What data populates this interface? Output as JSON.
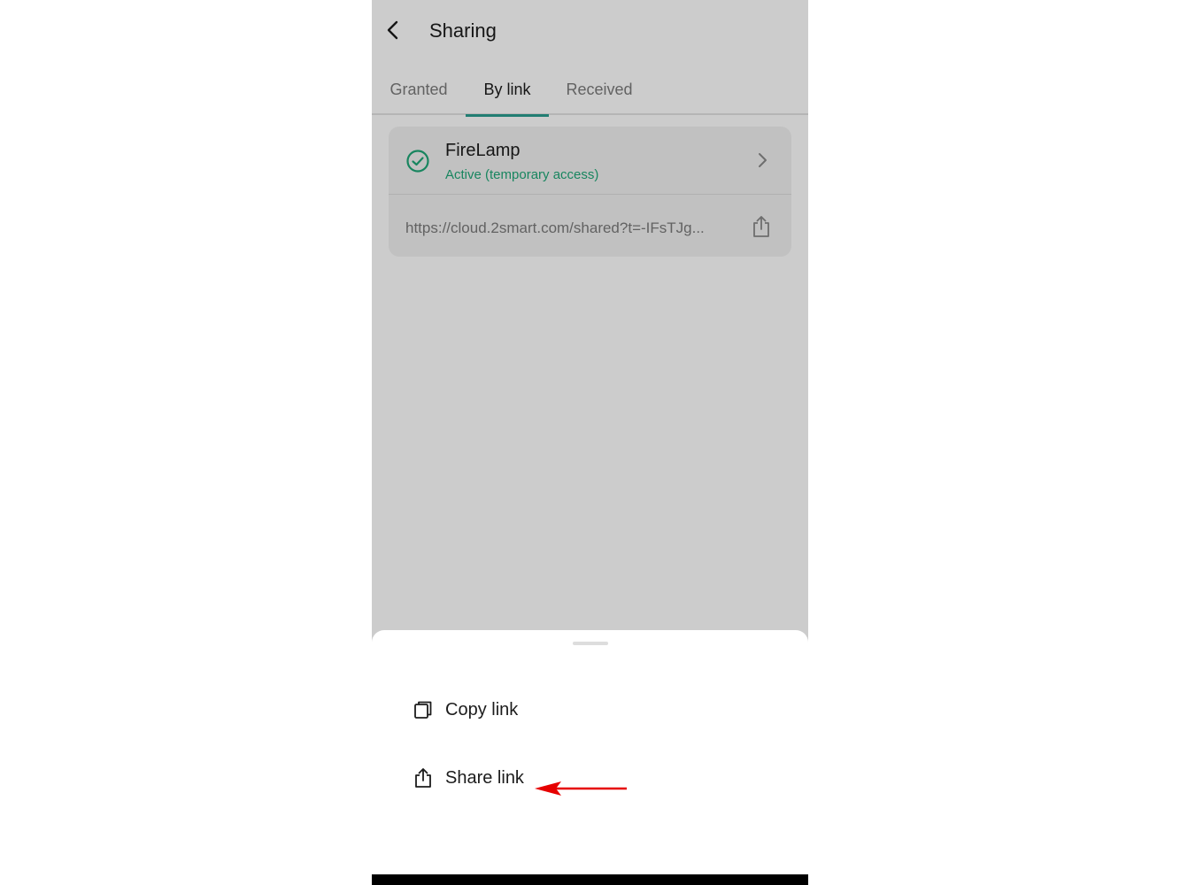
{
  "header": {
    "title": "Sharing",
    "back_icon": "chevron-left-icon"
  },
  "tabs": [
    {
      "label": "Granted",
      "active": false
    },
    {
      "label": "By link",
      "active": true
    },
    {
      "label": "Received",
      "active": false
    }
  ],
  "shared_item": {
    "name": "FireLamp",
    "status": "Active (temporary access)",
    "link": "https://cloud.2smart.com/shared?t=-IFsTJg...",
    "status_icon": "check-circle-icon",
    "share_icon": "share-icon"
  },
  "bottom_sheet": {
    "items": [
      {
        "label": "Copy link",
        "icon": "copy-icon"
      },
      {
        "label": "Share link",
        "icon": "share-icon"
      }
    ]
  },
  "colors": {
    "accent": "#2a9d8f",
    "status_active": "#1fa777",
    "annotation_arrow": "#e60000"
  }
}
